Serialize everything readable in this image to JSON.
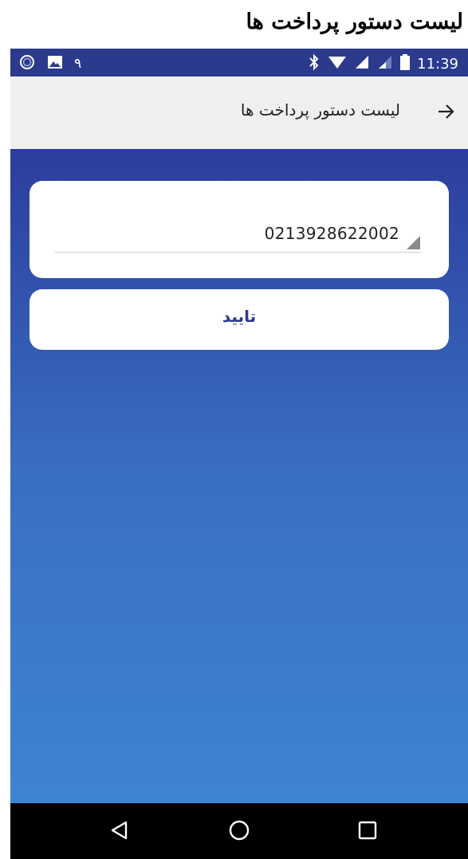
{
  "caption": {
    "text": "لیست دستور پرداخت ها"
  },
  "status_bar": {
    "time": "11:39",
    "notification_digit": "۹"
  },
  "app_bar": {
    "title": "لیست دستور پرداخت ها"
  },
  "form": {
    "account_select": {
      "selected_value": "0213928622002"
    },
    "confirm_button": {
      "label": "تایید"
    }
  },
  "colors": {
    "status_bar_bg": "#2b3a8c",
    "app_bar_bg": "#efefef",
    "gradient_top": "#2c3d9e",
    "gradient_bottom": "#3d84d3",
    "button_text": "#2b3a8c"
  },
  "icons": {
    "status_left": [
      "circle-sync-icon",
      "image-icon"
    ],
    "status_right": [
      "bluetooth-icon",
      "wifi-icon",
      "signal-icon",
      "signal-weak-icon",
      "battery-icon"
    ],
    "app_bar": [
      "back-arrow-icon"
    ],
    "nav_bar": [
      "nav-back-icon",
      "nav-home-icon",
      "nav-recents-icon"
    ]
  }
}
